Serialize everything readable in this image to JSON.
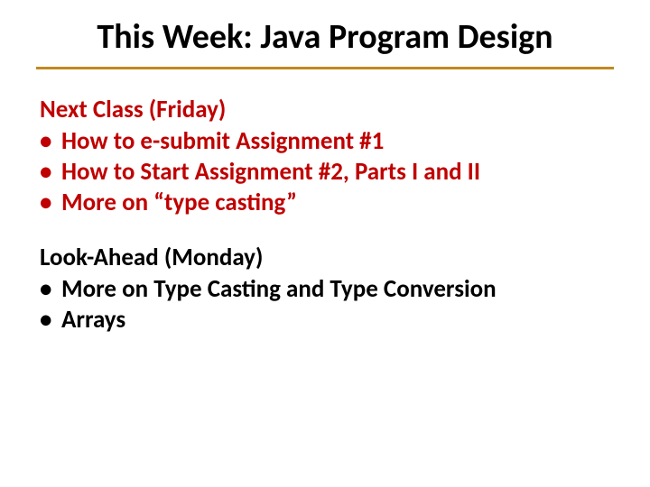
{
  "title": "This Week: Java Program Design",
  "sections": [
    {
      "heading": "Next Class (Friday)",
      "color": "red",
      "bullets": [
        "How to e-submit Assignment #1",
        "How to Start Assignment #2, Parts I and II",
        "More on “type casting”"
      ]
    },
    {
      "heading": "Look-Ahead (Monday)",
      "color": "black",
      "bullets": [
        "More on Type Casting and Type Conversion",
        "Arrays"
      ]
    }
  ]
}
